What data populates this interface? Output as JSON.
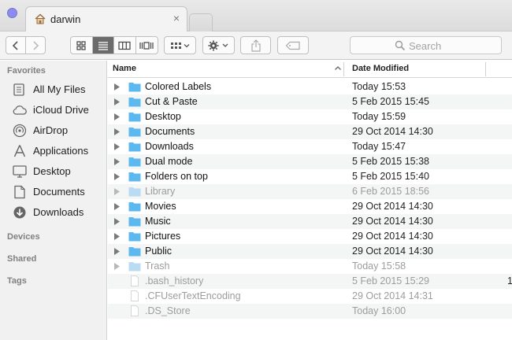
{
  "window": {
    "tab_title": "darwin"
  },
  "toolbar": {
    "search_placeholder": "Search",
    "icons": [
      "back-icon",
      "forward-icon",
      "icon-view-icon",
      "list-view-icon",
      "column-view-icon",
      "cover-flow-icon",
      "arrange-icon",
      "action-gear-icon",
      "share-icon",
      "tag-icon",
      "search-icon"
    ]
  },
  "sidebar": {
    "sections": {
      "favorites": "Favorites",
      "devices": "Devices",
      "shared": "Shared",
      "tags": "Tags"
    },
    "favorites": [
      {
        "label": "All My Files",
        "icon": "all-files-icon"
      },
      {
        "label": "iCloud Drive",
        "icon": "cloud-icon"
      },
      {
        "label": "AirDrop",
        "icon": "airdrop-icon"
      },
      {
        "label": "Applications",
        "icon": "applications-icon"
      },
      {
        "label": "Desktop",
        "icon": "desktop-icon"
      },
      {
        "label": "Documents",
        "icon": "documents-icon"
      },
      {
        "label": "Downloads",
        "icon": "downloads-icon"
      }
    ]
  },
  "list": {
    "columns": {
      "name": "Name",
      "date": "Date Modified"
    },
    "rows": [
      {
        "name": "Colored Labels",
        "date": "Today 15:53",
        "type": "folder"
      },
      {
        "name": "Cut & Paste",
        "date": "5 Feb 2015 15:45",
        "type": "folder"
      },
      {
        "name": "Desktop",
        "date": "Today 15:59",
        "type": "folder"
      },
      {
        "name": "Documents",
        "date": "29 Oct 2014 14:30",
        "type": "folder"
      },
      {
        "name": "Downloads",
        "date": "Today 15:47",
        "type": "folder"
      },
      {
        "name": "Dual mode",
        "date": "5 Feb 2015 15:38",
        "type": "folder"
      },
      {
        "name": "Folders on top",
        "date": "5 Feb 2015 15:40",
        "type": "folder"
      },
      {
        "name": "Library",
        "date": "6 Feb 2015 18:56",
        "type": "folder-hidden"
      },
      {
        "name": "Movies",
        "date": "29 Oct 2014 14:30",
        "type": "folder"
      },
      {
        "name": "Music",
        "date": "29 Oct 2014 14:30",
        "type": "folder"
      },
      {
        "name": "Pictures",
        "date": "29 Oct 2014 14:30",
        "type": "folder"
      },
      {
        "name": "Public",
        "date": "29 Oct 2014 14:30",
        "type": "folder"
      },
      {
        "name": "Trash",
        "date": "Today 15:58",
        "type": "folder-hidden"
      },
      {
        "name": ".bash_history",
        "date": "5 Feb 2015 15:29",
        "type": "file-hidden",
        "tail": "1"
      },
      {
        "name": ".CFUserTextEncoding",
        "date": "29 Oct 2014 14:31",
        "type": "file-hidden"
      },
      {
        "name": ".DS_Store",
        "date": "Today 16:00",
        "type": "file-hidden"
      }
    ]
  },
  "colors": {
    "folder": "#5cb8ee",
    "folder_hidden": "#b9dcf2",
    "selected_segment": "#6b6b6b",
    "sidebar_bg": "#f1f1f1"
  }
}
